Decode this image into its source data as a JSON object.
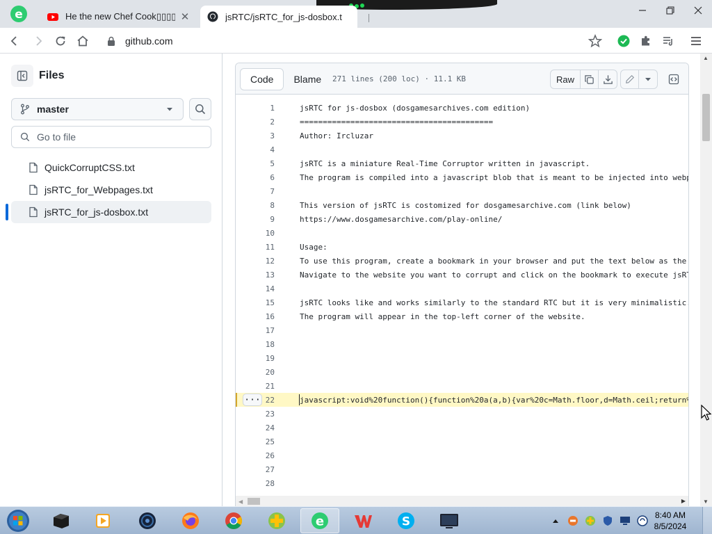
{
  "browser": {
    "tabs": [
      {
        "title": "He the new Chef Cook▯▯▯▯",
        "icon": "youtube-icon",
        "active": false
      },
      {
        "title": "jsRTC/jsRTC_for_js-dosbox.t",
        "icon": "github-icon",
        "active": true
      }
    ],
    "url": "github.com"
  },
  "sidebar": {
    "title": "Files",
    "branch": "master",
    "goto_placeholder": "Go to file",
    "files": [
      {
        "name": "QuickCorruptCSS.txt",
        "active": false
      },
      {
        "name": "jsRTC_for_Webpages.txt",
        "active": false
      },
      {
        "name": "jsRTC_for_js-dosbox.txt",
        "active": true
      }
    ]
  },
  "file": {
    "tab_code": "Code",
    "tab_blame": "Blame",
    "meta": "271 lines (200 loc) · 11.1 KB",
    "raw_label": "Raw",
    "highlighted_line": 22,
    "lines": [
      {
        "n": "1",
        "text": "jsRTC for js-dosbox (dosgamesarchives.com edition)"
      },
      {
        "n": "2",
        "text": "=========================================="
      },
      {
        "n": "3",
        "text": "Author: Ircluzar"
      },
      {
        "n": "4",
        "text": ""
      },
      {
        "n": "5",
        "text": "jsRTC is a miniature Real-Time Corruptor written in javascript."
      },
      {
        "n": "6",
        "text": "The program is compiled into a javascript blob that is meant to be injected into webp"
      },
      {
        "n": "7",
        "text": ""
      },
      {
        "n": "8",
        "text": "This version of jsRTC is costomized for dosgamesarchive.com (link below)"
      },
      {
        "n": "9",
        "text": "https://www.dosgamesarchive.com/play-online/"
      },
      {
        "n": "10",
        "text": ""
      },
      {
        "n": "11",
        "text": "Usage:"
      },
      {
        "n": "12",
        "text": "To use this program, create a bookmark in your browser and put the text below as the"
      },
      {
        "n": "13",
        "text": "Navigate to the website you want to corrupt and click on the bookmark to execute jsRT"
      },
      {
        "n": "14",
        "text": ""
      },
      {
        "n": "15",
        "text": "jsRTC looks like and works similarly to the standard RTC but it is very minimalistic."
      },
      {
        "n": "16",
        "text": "The program will appear in the top-left corner of the website."
      },
      {
        "n": "17",
        "text": ""
      },
      {
        "n": "18",
        "text": ""
      },
      {
        "n": "19",
        "text": ""
      },
      {
        "n": "20",
        "text": ""
      },
      {
        "n": "21",
        "text": ""
      },
      {
        "n": "22",
        "text": "javascript:void%20function(){function%20a(a,b){var%20c=Math.floor,d=Math.ceil;return%"
      },
      {
        "n": "23",
        "text": ""
      },
      {
        "n": "24",
        "text": ""
      },
      {
        "n": "25",
        "text": ""
      },
      {
        "n": "26",
        "text": ""
      },
      {
        "n": "27",
        "text": ""
      },
      {
        "n": "28",
        "text": ""
      }
    ]
  },
  "taskbar": {
    "time": "8:40 AM",
    "date": "8/5/2024"
  }
}
